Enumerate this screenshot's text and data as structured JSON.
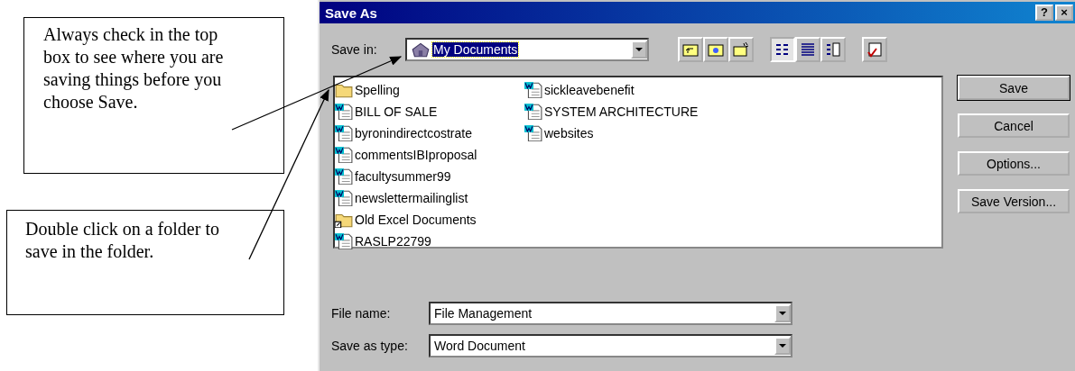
{
  "callouts": [
    {
      "text": "Always check in the top box to see where you are saving things before you choose Save."
    },
    {
      "text": "Double click on a folder to save in the folder."
    }
  ],
  "window": {
    "title": "Save As",
    "title_buttons": [
      "?",
      "×"
    ]
  },
  "save_in": {
    "label": "Save in:",
    "value": "My Documents"
  },
  "toolbar": [
    {
      "kind": "up",
      "selected": false
    },
    {
      "kind": "web",
      "selected": false
    },
    {
      "kind": "newfolder",
      "selected": false
    },
    {
      "kind": "list",
      "selected": true
    },
    {
      "kind": "details",
      "selected": false
    },
    {
      "kind": "properties",
      "selected": false
    },
    {
      "kind": "tools",
      "selected": false
    }
  ],
  "files": [
    {
      "name": "Spelling",
      "kind": "folder"
    },
    {
      "name": "BILL OF SALE",
      "kind": "doc"
    },
    {
      "name": "byronindirectcostrate",
      "kind": "doc"
    },
    {
      "name": "commentsIBIproposal",
      "kind": "doc"
    },
    {
      "name": "facultysummer99",
      "kind": "doc"
    },
    {
      "name": "newslettermailinglist",
      "kind": "doc"
    },
    {
      "name": "Old Excel Documents",
      "kind": "shortcut"
    },
    {
      "name": "RASLP22799",
      "kind": "doc"
    },
    {
      "name": "sickleavebenefit",
      "kind": "doc"
    },
    {
      "name": "SYSTEM ARCHITECTURE",
      "kind": "doc"
    },
    {
      "name": "websites",
      "kind": "doc"
    }
  ],
  "buttons": [
    "Save",
    "Cancel",
    "Options...",
    "Save Version..."
  ],
  "file_name": {
    "label": "File name:",
    "value": "File Management"
  },
  "save_as_type": {
    "label": "Save as type:",
    "value": "Word Document"
  }
}
